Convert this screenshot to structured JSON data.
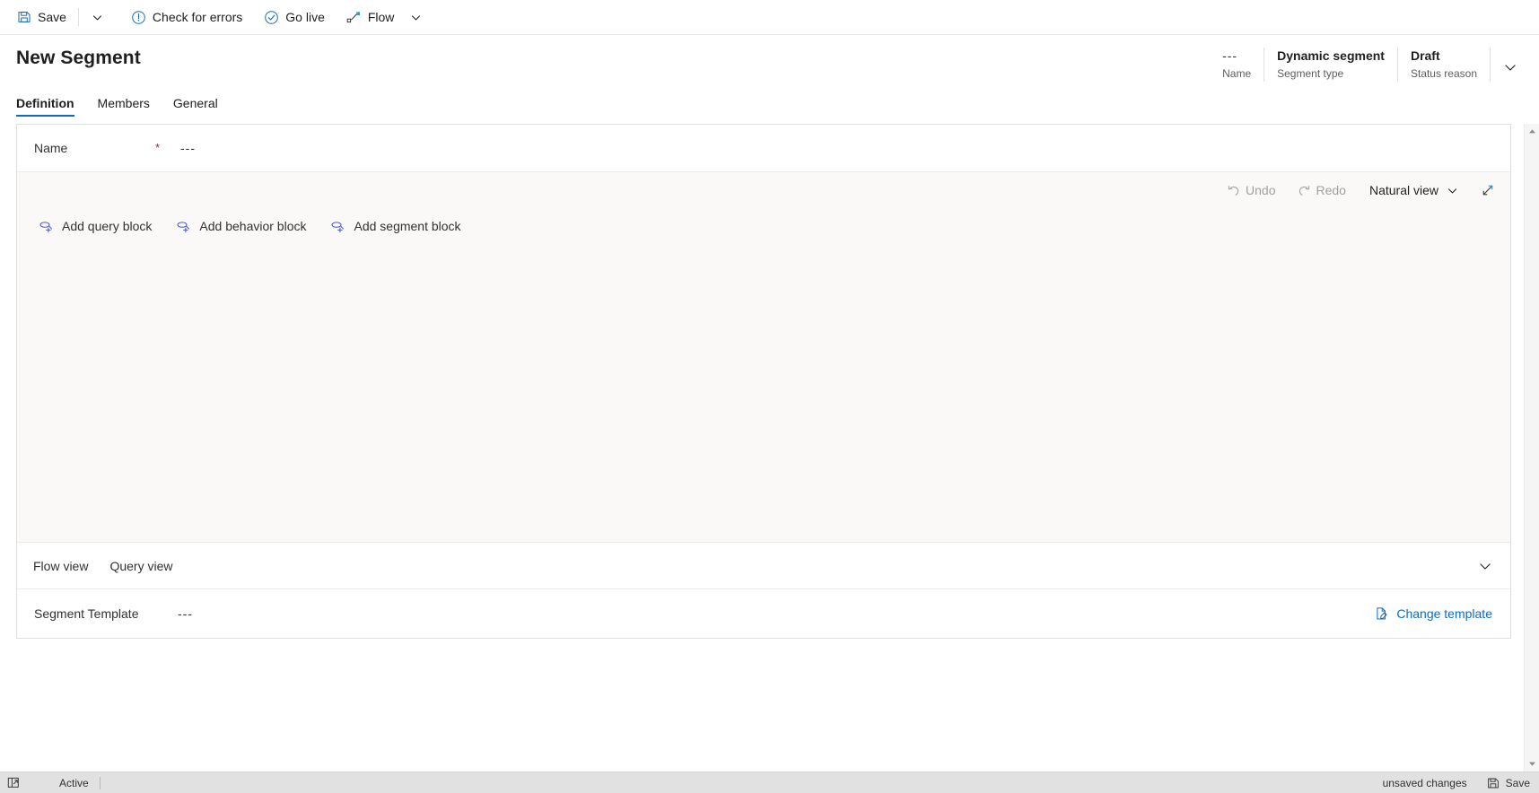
{
  "commandbar": {
    "items": [
      {
        "label": "Save",
        "icon": "save-icon"
      },
      {
        "label": "Check for errors",
        "icon": "error-circle-icon"
      },
      {
        "label": "Go live",
        "icon": "check-circle-icon"
      },
      {
        "label": "Flow",
        "icon": "flow-icon"
      }
    ],
    "save_caret_icon": "chevron-down-icon",
    "flow_caret_icon": "chevron-down-icon"
  },
  "header": {
    "title": "New Segment",
    "fields": [
      {
        "value": "---",
        "label": "Name",
        "bold": false
      },
      {
        "value": "Dynamic segment",
        "label": "Segment type",
        "bold": true
      },
      {
        "value": "Draft",
        "label": "Status reason",
        "bold": true
      }
    ],
    "collapse_icon": "chevron-down-icon"
  },
  "tabs": [
    {
      "label": "Definition",
      "active": true
    },
    {
      "label": "Members",
      "active": false
    },
    {
      "label": "General",
      "active": false
    }
  ],
  "form": {
    "name_label": "Name",
    "name_required_marker": "*",
    "name_value": "---"
  },
  "canvas": {
    "toolbar": {
      "undo_label": "Undo",
      "undo_icon": "undo-icon",
      "undo_disabled": true,
      "redo_label": "Redo",
      "redo_icon": "redo-icon",
      "redo_disabled": true,
      "view_mode_label": "Natural view",
      "view_mode_caret_icon": "chevron-down-icon",
      "expand_icon": "expand-diagonal-icon"
    },
    "block_actions": [
      {
        "label": "Add query block",
        "icon": "add-query-block-icon"
      },
      {
        "label": "Add behavior block",
        "icon": "add-behavior-block-icon"
      },
      {
        "label": "Add segment block",
        "icon": "add-segment-block-icon"
      }
    ]
  },
  "viewbar": {
    "tabs": [
      {
        "label": "Flow view"
      },
      {
        "label": "Query view"
      }
    ],
    "collapse_icon": "chevron-down-icon"
  },
  "template": {
    "label": "Segment Template",
    "value": "---",
    "change_label": "Change template",
    "change_icon": "edit-page-icon"
  },
  "statusbar": {
    "popout_icon": "popout-icon",
    "state": "Active",
    "unsaved_text": "unsaved changes",
    "save_label": "Save",
    "save_icon": "save-icon"
  },
  "scrollbar": {
    "up_icon": "triangle-up-icon",
    "down_icon": "triangle-down-icon"
  },
  "colors": {
    "accent": "#0f6cbd",
    "required": "#a4262c",
    "canvas_bg": "#faf9f8",
    "statusbar_bg": "#e1e1e1"
  }
}
